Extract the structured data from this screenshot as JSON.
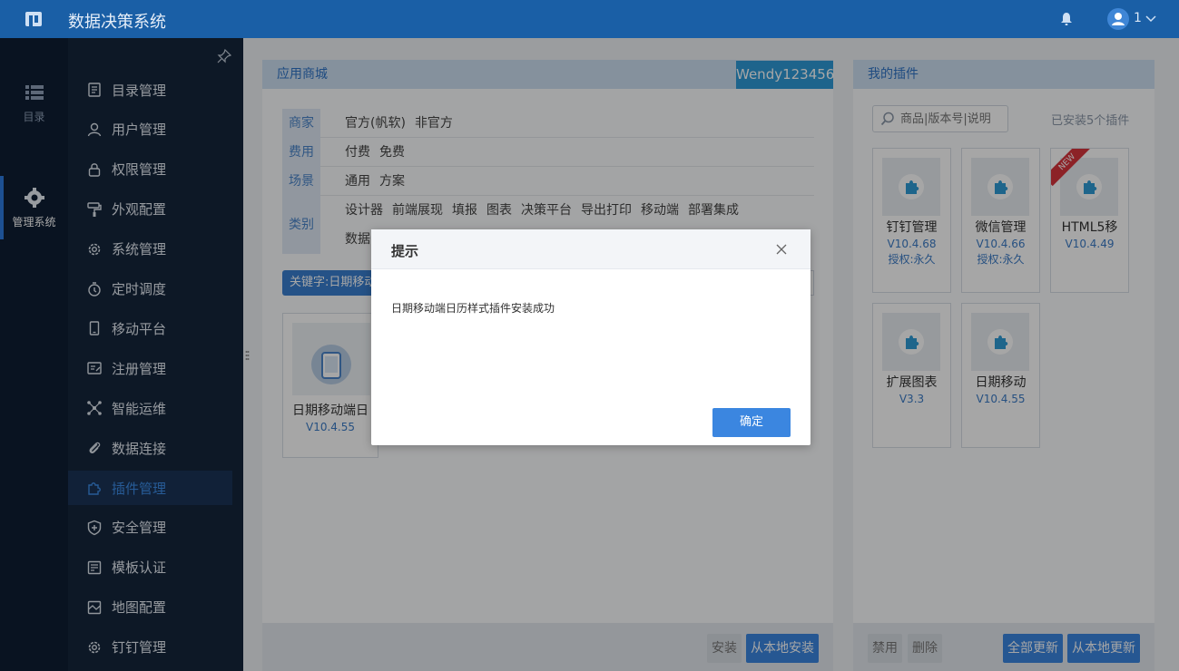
{
  "app": {
    "title": "数据决策系统",
    "user": "1"
  },
  "rail": [
    {
      "label": "目录",
      "icon": "list-icon"
    },
    {
      "label": "管理系统",
      "icon": "gear-icon"
    }
  ],
  "sidebar": {
    "items": [
      {
        "label": "目录管理",
        "icon": "catalog-icon"
      },
      {
        "label": "用户管理",
        "icon": "user-icon"
      },
      {
        "label": "权限管理",
        "icon": "lock-icon"
      },
      {
        "label": "外观配置",
        "icon": "brush-icon"
      },
      {
        "label": "系统管理",
        "icon": "gear-icon"
      },
      {
        "label": "定时调度",
        "icon": "timer-icon"
      },
      {
        "label": "移动平台",
        "icon": "mobile-icon"
      },
      {
        "label": "注册管理",
        "icon": "register-icon"
      },
      {
        "label": "智能运维",
        "icon": "network-icon"
      },
      {
        "label": "数据连接",
        "icon": "paperclip-icon"
      },
      {
        "label": "插件管理",
        "icon": "puzzle-icon",
        "active": true
      },
      {
        "label": "安全管理",
        "icon": "shield-icon"
      },
      {
        "label": "模板认证",
        "icon": "template-icon"
      },
      {
        "label": "地图配置",
        "icon": "map-icon"
      },
      {
        "label": "钉钉管理",
        "icon": "gear-icon"
      }
    ]
  },
  "store": {
    "title": "应用商城",
    "account": "Wendy123456",
    "filters": [
      {
        "key": "商家",
        "values": [
          "官方(帆软)",
          "非官方"
        ]
      },
      {
        "key": "费用",
        "values": [
          "付费",
          "免费"
        ]
      },
      {
        "key": "场景",
        "values": [
          "通用",
          "方案"
        ]
      },
      {
        "key": "类别",
        "values": [
          "设计器",
          "前端展现",
          "填报",
          "图表",
          "决策平台",
          "导出打印",
          "移动端",
          "部署集成"
        ],
        "values2": [
          "数据"
        ]
      }
    ],
    "keyword": "关键字:日期移动",
    "result": {
      "name": "日期移动端日",
      "version": "V10.4.55"
    },
    "install_label": "安装",
    "install_local_label": "从本地安装"
  },
  "mine": {
    "title": "我的插件",
    "search_placeholder": "商品|版本号|说明",
    "installed_count": "已安装5个插件",
    "plugins": [
      {
        "name": "钉钉管理",
        "version": "V10.4.68",
        "auth": "授权:永久"
      },
      {
        "name": "微信管理",
        "version": "V10.4.66",
        "auth": "授权:永久"
      },
      {
        "name": "HTML5移",
        "version": "V10.4.49",
        "auth": "",
        "badge": "NEW"
      },
      {
        "name": "扩展图表",
        "version": "V3.3",
        "auth": ""
      },
      {
        "name": "日期移动",
        "version": "V10.4.55",
        "auth": ""
      }
    ],
    "disable_label": "禁用",
    "delete_label": "删除",
    "update_all_label": "全部更新",
    "update_local_label": "从本地更新"
  },
  "modal": {
    "title": "提示",
    "message": "日期移动端日历样式插件安装成功",
    "ok_label": "确定"
  }
}
